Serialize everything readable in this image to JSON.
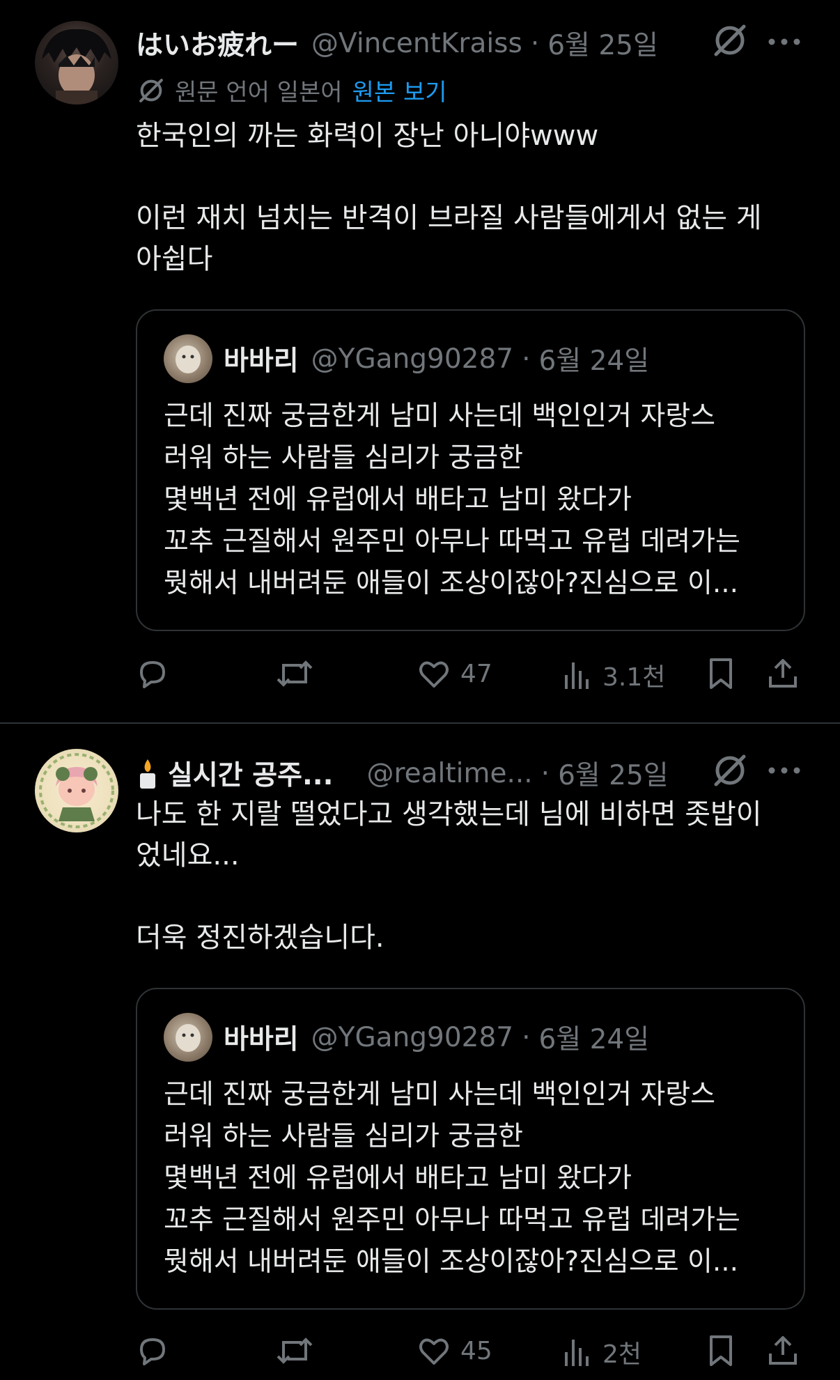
{
  "tweets": [
    {
      "name": "はいお疲れー",
      "handle": "@VincentKraiss",
      "dot": "·",
      "date": "6월 25일",
      "translation": {
        "language": "원문 언어 일본어",
        "view_original": "원본 보기"
      },
      "body": "한국인의 까는 화력이 장난 아니야www\n\n이런 재치 넘치는 반격이 브라질 사람들에게서 없는 게\n아쉽다",
      "quote": {
        "name": "바바리",
        "handle": "@YGang90287",
        "dot": "·",
        "date": "6월 24일",
        "text": "근데 진짜 궁금한게 남미 사는데 백인인거  자랑스\n러워 하는 사람들 심리가 궁금한\n몇백년 전에 유럽에서 배타고 남미 왔다가\n꼬추 근질해서 원주민 아무나 따먹고 유럽 데려가는\n뭣해서 내버려둔 애들이 조상이잖아?진심으로 이..."
      },
      "actions": {
        "likes": "47",
        "views": "3.1천"
      }
    },
    {
      "name": "실시간 공주...",
      "name_emoji": "candle",
      "handle": "@realtime...",
      "dot": "·",
      "date": "6월 25일",
      "body": "나도 한 지랄 떨었다고 생각했는데 님에 비하면 좃밥이\n었네요...\n\n더욱 정진하겠습니다.",
      "quote": {
        "name": "바바리",
        "handle": "@YGang90287",
        "dot": "·",
        "date": "6월 24일",
        "text": "근데 진짜 궁금한게 남미 사는데 백인인거  자랑스\n러워 하는 사람들 심리가 궁금한\n몇백년 전에 유럽에서 배타고 남미 왔다가\n꼬추 근질해서 원주민 아무나 따먹고 유럽 데려가는\n뭣해서 내버려둔 애들이 조상이잖아?진심으로 이..."
      },
      "actions": {
        "likes": "45",
        "views": "2천"
      }
    }
  ],
  "colors": {
    "background": "#000000",
    "text": "#e7e9ea",
    "muted": "#71767b",
    "link": "#1d9bf0",
    "border": "#2f3336"
  },
  "icons": [
    "grok-icon",
    "more-icon",
    "translate-icon",
    "reply-icon",
    "retweet-icon",
    "like-icon",
    "views-icon",
    "bookmark-icon",
    "share-icon"
  ]
}
